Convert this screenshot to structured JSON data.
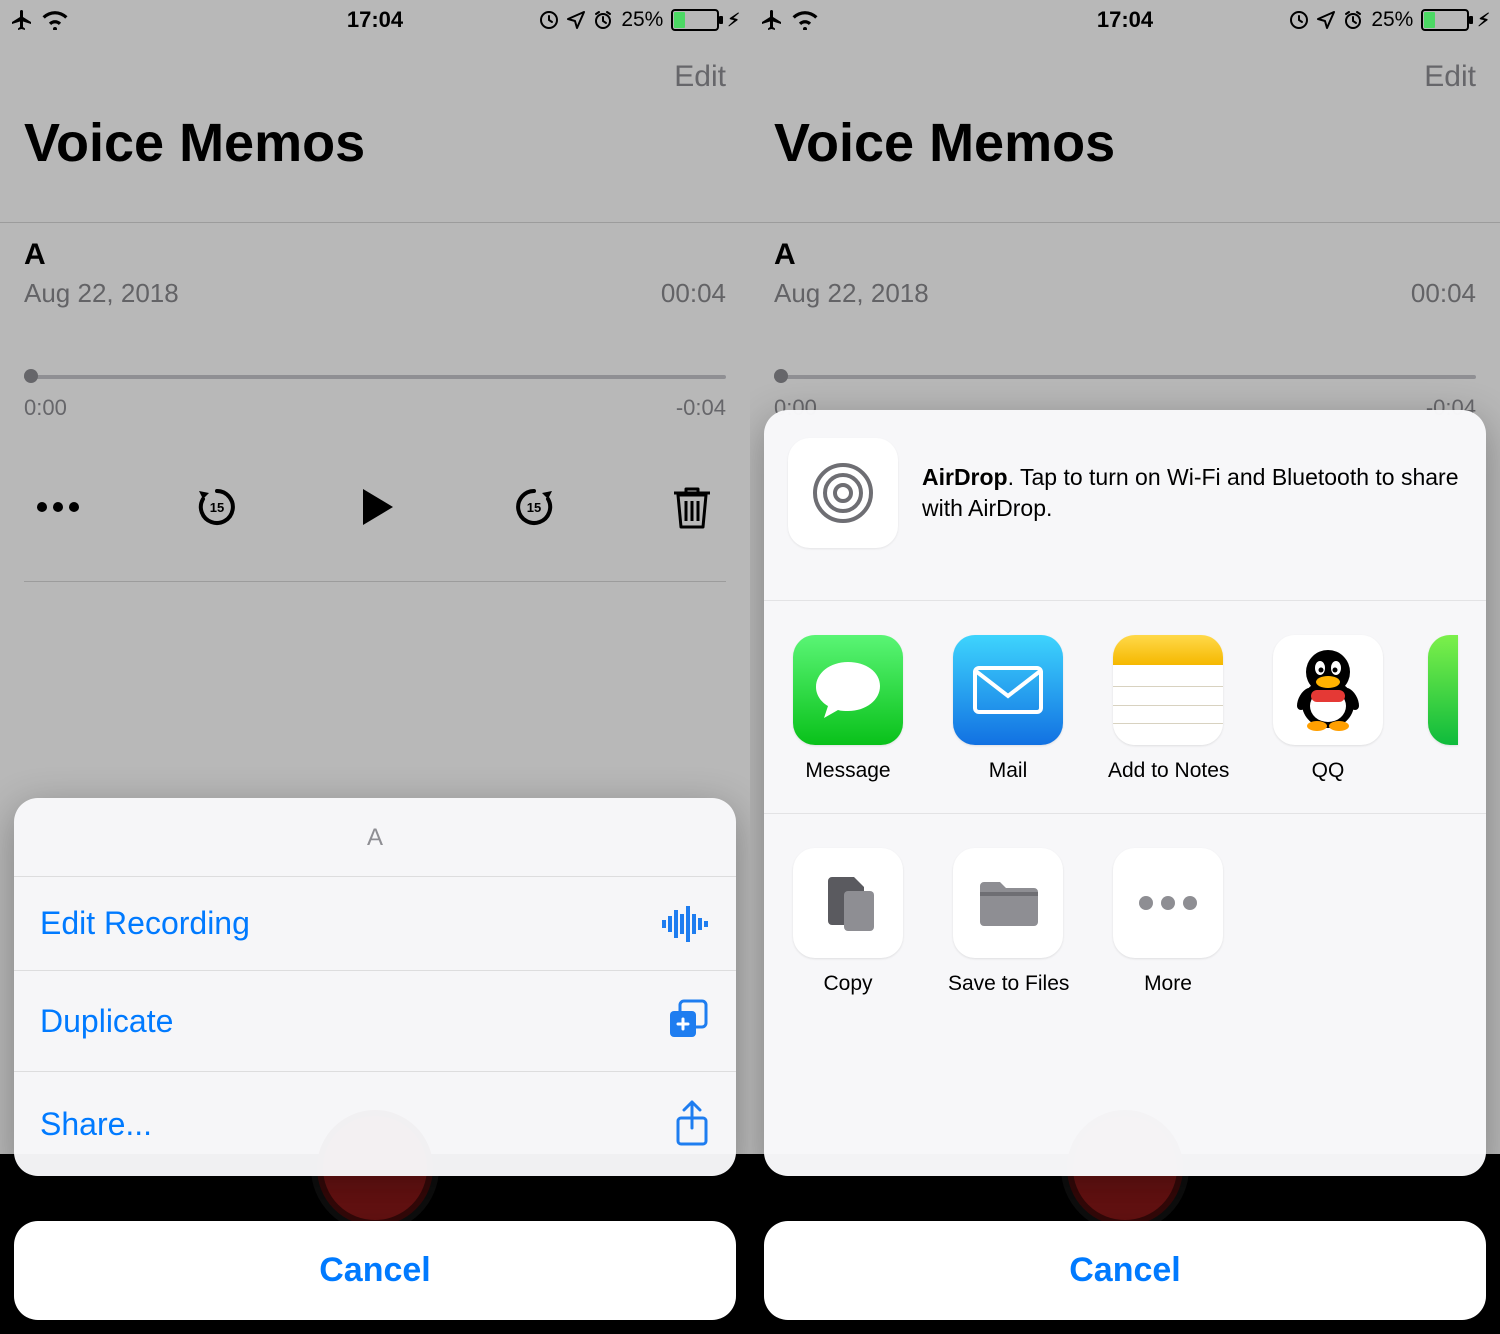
{
  "status": {
    "time": "17:04",
    "battery_pct": "25%"
  },
  "header": {
    "edit": "Edit",
    "title": "Voice Memos"
  },
  "memo": {
    "title": "A",
    "date": "Aug 22, 2018",
    "duration": "00:04",
    "time_start": "0:00",
    "time_end": "-0:04"
  },
  "action_sheet": {
    "title": "A",
    "items": [
      {
        "label": "Edit Recording"
      },
      {
        "label": "Duplicate"
      },
      {
        "label": "Share..."
      }
    ],
    "cancel": "Cancel"
  },
  "share_sheet": {
    "airdrop_bold": "AirDrop",
    "airdrop_text": ". Tap to turn on Wi-Fi and Bluetooth to share with AirDrop.",
    "apps": [
      {
        "label": "Message"
      },
      {
        "label": "Mail"
      },
      {
        "label": "Add to Notes"
      },
      {
        "label": "QQ"
      }
    ],
    "actions": [
      {
        "label": "Copy"
      },
      {
        "label": "Save to Files"
      },
      {
        "label": "More"
      }
    ],
    "cancel": "Cancel"
  }
}
